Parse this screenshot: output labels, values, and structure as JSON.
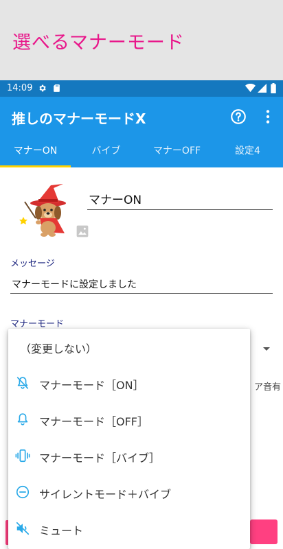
{
  "banner": {
    "title": "選べるマナーモード"
  },
  "status": {
    "time": "14:09",
    "icons": [
      "gear-icon",
      "sd-card-icon",
      "wifi-icon",
      "signal-icon",
      "battery-icon"
    ]
  },
  "appbar": {
    "title": "推しのマナーモードX",
    "actions": [
      "help-icon",
      "more-vert-icon"
    ]
  },
  "tabs": [
    {
      "label": "マナーON",
      "active": true
    },
    {
      "label": "バイブ",
      "active": false
    },
    {
      "label": "マナーOFF",
      "active": false
    },
    {
      "label": "設定4",
      "active": false
    }
  ],
  "profile": {
    "name_value": "マナーON",
    "image_icon": "image-placeholder-icon"
  },
  "message": {
    "label": "メッセージ",
    "value": "マナーモードに設定しました"
  },
  "manner_mode": {
    "label": "マナーモード",
    "peek_text": "ア音有"
  },
  "menu": {
    "items": [
      {
        "label": "（変更しない）",
        "icon": ""
      },
      {
        "label": "マナーモード［ON］",
        "icon": "bell-off-icon"
      },
      {
        "label": "マナーモード［OFF］",
        "icon": "bell-icon"
      },
      {
        "label": "マナーモード［バイブ］",
        "icon": "vibrate-icon"
      },
      {
        "label": "サイレントモード＋バイブ",
        "icon": "minus-circle-icon"
      },
      {
        "label": "ミュート",
        "icon": "volume-off-icon"
      }
    ]
  },
  "colors": {
    "appbar": "#1c96e8",
    "statusbar": "#1478bf",
    "accent": "#ffd200",
    "menu_icon": "#29a9e8",
    "banner_text": "#e8168a",
    "pink": "#ff4081"
  }
}
